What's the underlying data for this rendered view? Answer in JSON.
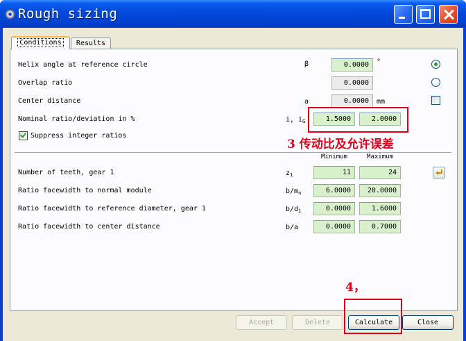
{
  "window": {
    "title": "Rough sizing"
  },
  "tabs": [
    {
      "label": "Conditions",
      "active": true
    },
    {
      "label": "Results",
      "active": false
    }
  ],
  "rows": {
    "helix": {
      "label": "Helix angle at reference circle",
      "symbol": "β",
      "value": "0.0000",
      "unit": "°",
      "radio_selected": true
    },
    "overlap": {
      "label": "Overlap ratio",
      "value": "0.0000",
      "radio_selected": false
    },
    "center": {
      "label": "Center distance",
      "symbol": "a",
      "value": "0.0000",
      "unit": "mm",
      "checked": false
    },
    "nominal": {
      "label": "Nominal ratio/deviation in %",
      "symbol": "i, i",
      "symbol_sub": "G",
      "value1": "1.5000",
      "value2": "2.0000"
    },
    "suppress": {
      "label": "Suppress integer ratios",
      "checked": true
    }
  },
  "columns": {
    "min": "Minimum",
    "max": "Maximum"
  },
  "range_rows": [
    {
      "label": "Number of teeth, gear 1",
      "symbol": "z",
      "symbol_sub": "1",
      "min": "11",
      "max": "24"
    },
    {
      "label": "Ratio facewidth to normal module",
      "symbol": "b/m",
      "symbol_sub": "n",
      "min": "6.0000",
      "max": "20.0000"
    },
    {
      "label": "Ratio facewidth to reference diameter, gear 1",
      "symbol": "b/d",
      "symbol_sub": "1",
      "min": "0.0000",
      "max": "1.6000"
    },
    {
      "label": "Ratio facewidth to center distance",
      "symbol": "b/a",
      "symbol_sub": "",
      "min": "0.0000",
      "max": "0.7000"
    }
  ],
  "buttons": {
    "accept": "Accept",
    "delete": "Delete",
    "calculate": "Calculate",
    "close": "Close"
  },
  "annotations": {
    "ratio_note": "3 传动比及允许误差",
    "step_note": "4，"
  },
  "colors": {
    "field_green": "#d8f0cc",
    "annotation_red": "#e0001a",
    "title_blue": "#0349dc"
  }
}
